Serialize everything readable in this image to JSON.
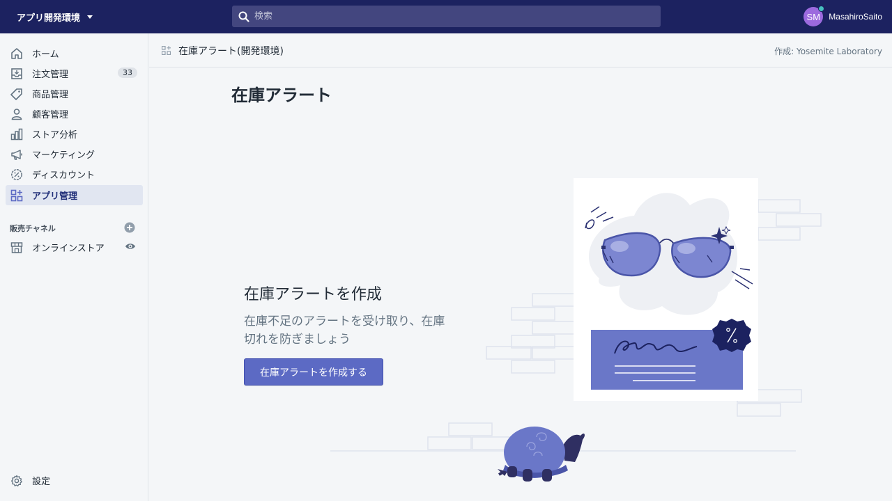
{
  "topbar": {
    "store_name": "アプリ開発環境",
    "search_placeholder": "検索",
    "user_initials": "SM",
    "user_name": "MasahiroSaito"
  },
  "sidebar": {
    "items": [
      {
        "label": "ホーム"
      },
      {
        "label": "注文管理",
        "badge": "33"
      },
      {
        "label": "商品管理"
      },
      {
        "label": "顧客管理"
      },
      {
        "label": "ストア分析"
      },
      {
        "label": "マーケティング"
      },
      {
        "label": "ディスカウント"
      },
      {
        "label": "アプリ管理"
      }
    ],
    "sales_channels_title": "販売チャネル",
    "online_store": "オンラインストア",
    "settings": "設定"
  },
  "header": {
    "app_title": "在庫アラート(開発環境)",
    "creator": "作成: Yosemite Laboratory"
  },
  "main": {
    "page_title": "在庫アラート",
    "empty_heading": "在庫アラートを作成",
    "empty_text": "在庫不足のアラートを受け取り、在庫切れを防ぎましょう",
    "button_label": "在庫アラートを作成する"
  },
  "colors": {
    "topbar": "#1c2260",
    "accent": "#5c6ac4",
    "active_nav_bg": "#e1e6f1"
  }
}
